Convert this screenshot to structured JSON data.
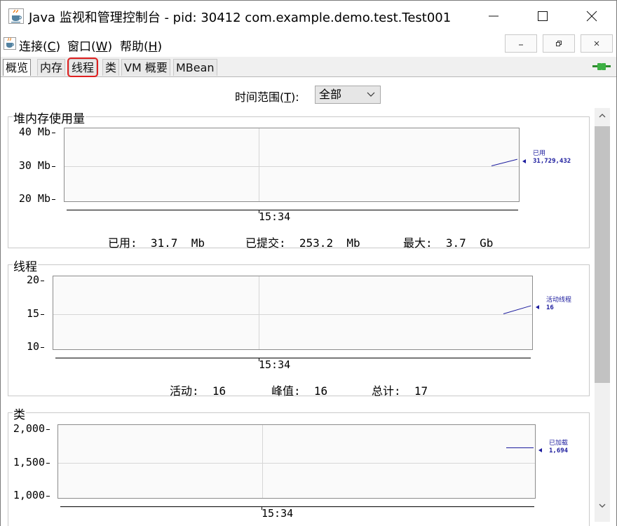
{
  "window": {
    "title": "Java 监视和管理控制台 - pid: 30412 com.example.demo.test.Test001",
    "app_icon": "java-cup-icon",
    "controls": {
      "minimize": "—",
      "maximize": "☐",
      "close": "✕"
    }
  },
  "menubar": {
    "items": [
      {
        "label": "连接",
        "mnemonic": "C"
      },
      {
        "label": "窗口",
        "mnemonic": "W"
      },
      {
        "label": "帮助",
        "mnemonic": "H"
      }
    ],
    "mdi": {
      "minimize": "▁",
      "restore": "❐",
      "close": "✕"
    }
  },
  "tabs": [
    {
      "label": "概览",
      "selected": true,
      "highlighted": false
    },
    {
      "label": "内存",
      "selected": false,
      "highlighted": false
    },
    {
      "label": "线程",
      "selected": false,
      "highlighted": true
    },
    {
      "label": "类",
      "selected": false,
      "highlighted": false
    },
    {
      "label": "VM 概要",
      "selected": false,
      "highlighted": false
    },
    {
      "label": "MBean",
      "selected": false,
      "highlighted": false
    }
  ],
  "connection_icon": "connection-plug-icon",
  "time_range": {
    "label_prefix": "时间范围(",
    "mnemonic": "T",
    "label_suffix": "):",
    "selected": "全部"
  },
  "accent_colors": {
    "series": "#1c1c9e",
    "highlight": "#e02020"
  },
  "chart_data": [
    {
      "type": "line",
      "title": "堆内存使用量",
      "y_ticks": [
        "40 Mb",
        "30 Mb",
        "20 Mb"
      ],
      "ylim": [
        20,
        40
      ],
      "y_unit": "Mb",
      "x_ticks": [
        "15:34"
      ],
      "series": [
        {
          "name": "已用",
          "label_value": "31,729,432",
          "points": [
            [
              0,
              29.9
            ],
            [
              1,
              31.7
            ]
          ]
        }
      ],
      "stats": [
        {
          "label": "已用:",
          "value": "31.7  Mb"
        },
        {
          "label": "已提交:",
          "value": "253.2  Mb"
        },
        {
          "label": "最大:",
          "value": "3.7  Gb"
        }
      ]
    },
    {
      "type": "line",
      "title": "线程",
      "y_ticks": [
        "20",
        "15",
        "10"
      ],
      "ylim": [
        10,
        20
      ],
      "x_ticks": [
        "15:34"
      ],
      "series": [
        {
          "name": "活动线程",
          "label_value": "16",
          "points": [
            [
              0,
              14.9
            ],
            [
              1,
              16
            ]
          ]
        }
      ],
      "stats": [
        {
          "label": "活动:",
          "value": "16"
        },
        {
          "label": "峰值:",
          "value": "16"
        },
        {
          "label": "总计:",
          "value": "17"
        }
      ]
    },
    {
      "type": "line",
      "title": "类",
      "y_ticks": [
        "2,000",
        "1,500",
        "1,000"
      ],
      "ylim": [
        1000,
        2000
      ],
      "x_ticks": [
        "15:34"
      ],
      "series": [
        {
          "name": "已加载",
          "label_value": "1,694",
          "points": [
            [
              0,
              1694
            ],
            [
              1,
              1694
            ]
          ]
        }
      ],
      "stats": []
    }
  ]
}
